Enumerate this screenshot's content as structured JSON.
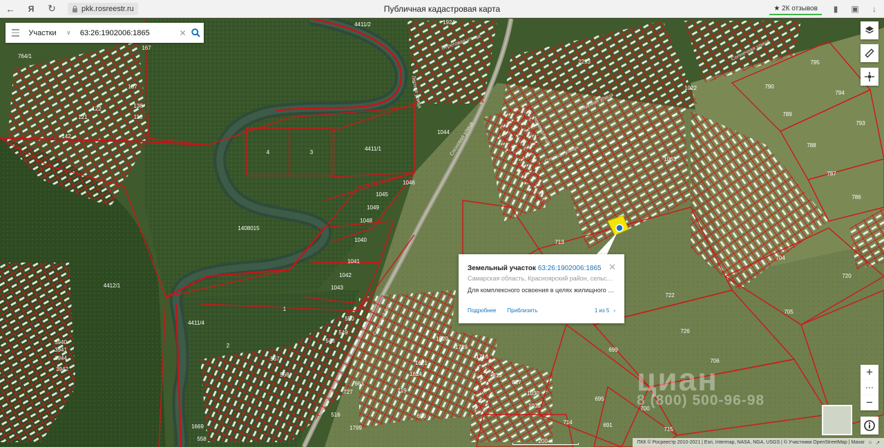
{
  "browser": {
    "url": "pkk.rosreestr.ru",
    "title": "Публичная кадастровая карта",
    "reviews": "★ 2К отзывов"
  },
  "search": {
    "type": "Участки",
    "value": "63:26:1902006:1865"
  },
  "map_labels": {
    "parcel_4": "4",
    "parcel_3": "3",
    "parcel_4411_1": "4411/1",
    "parcel_1408015": "1408015",
    "parcel_4412_1": "4412/1",
    "parcel_1": "1",
    "parcel_2": "2",
    "parcel_4411_4": "4411/4",
    "parcel_764_1": "764/1",
    "parcel_4411_2": "4411/2",
    "parcel_713": "713",
    "parcel_699": "699",
    "parcel_722": "722",
    "parcel_726": "726",
    "parcel_706": "706",
    "parcel_705": "705",
    "parcel_704": "704",
    "parcel_720": "720",
    "parcel_700": "700",
    "parcel_715": "715",
    "parcel_714": "714",
    "parcel_695": "695",
    "parcel_691": "691",
    "parcel_696": "696",
    "parcel_719": "719",
    "parcel_790": "790",
    "parcel_789": "789",
    "parcel_788": "788",
    "parcel_787": "787",
    "parcel_786": "786",
    "parcel_794": "794",
    "parcel_793": "793",
    "parcel_795": "795",
    "parcel_1044": "1044",
    "parcel_1045": "1045",
    "parcel_1046": "1046",
    "parcel_1040": "1040",
    "parcel_1041": "1041",
    "parcel_1042": "1042",
    "parcel_1043": "1043",
    "parcel_1048": "1048",
    "parcel_1049": "1049",
    "parcel_167": "167",
    "parcel_142": "142",
    "parcel_121": "121",
    "parcel_122": "122",
    "parcel_137": "137",
    "parcel_138": "138",
    "parcel_116": "116",
    "parcel_550": "550",
    "parcel_549": "549",
    "parcel_548": "548",
    "parcel_567": "567",
    "parcel_568": "568",
    "parcel_3940": "3940",
    "parcel_3941": "3941",
    "parcel_3942": "3942",
    "parcel_3944": "3944",
    "parcel_2253": "2253",
    "parcel_1924": "1924",
    "parcel_1022": "1022",
    "parcel_1716": "1716",
    "parcel_1729": "1729",
    "parcel_1799": "1799",
    "parcel_1063": "1063",
    "parcel_1620": "1620",
    "parcel_1621": "1621",
    "parcel_1624": "1624",
    "parcel_1669": "1669",
    "parcel_558": "558",
    "parcel_727": "727",
    "parcel_516": "516",
    "parcel_813": "813",
    "parcel_817": "817",
    "parcel_1030": "1030",
    "parcel_1035": "1035",
    "parcel_663": "663"
  },
  "streets": {
    "beregovaya": "Береговая улица",
    "sosnovaya": "Сосновая улица",
    "stepnaya": "Степная улица",
    "sadovaya": "Садовая улица",
    "sosnovy_bor": "Сосновый бор",
    "solnechnaya": "Солнечная улица",
    "lesnaya": "Лесная улица",
    "novaya": "Новая улица"
  },
  "popup": {
    "title_prefix": "Земельный участок",
    "cadastral_number": "63:26:1902006:1865",
    "address": "Самарская область, Красноярский район, сельское ...",
    "permitted_use": "Для комплексного освоения в целях жилищного ст...",
    "details_link": "Подробнее",
    "zoom_link": "Приблизить",
    "pager": "1 из 5"
  },
  "watermark": {
    "brand": "циан",
    "phone": "8 (800) 500-96-98"
  },
  "scale_label": "200 м",
  "attribution": "ПКК © Росреестр 2010-2021 | Esri, Intermap, NASA, NGA, USGS | © Участники OpenStreetMap | Maxar",
  "colors": {
    "parcel_border": "#d0161a",
    "selected_parcel": "#f2e600",
    "link": "#1a73b8"
  }
}
